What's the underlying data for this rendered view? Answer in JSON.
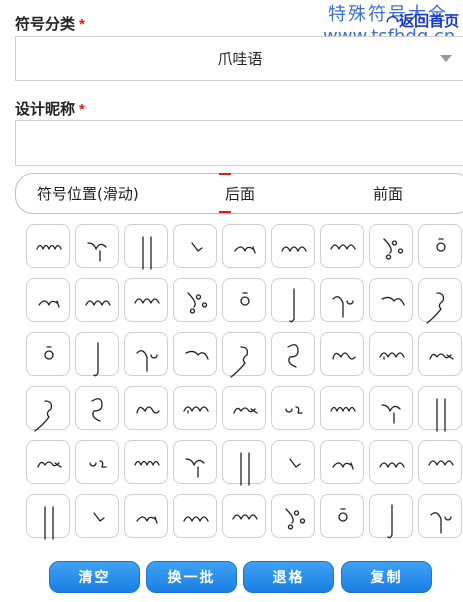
{
  "watermark": {
    "site_name": "特殊符号大全",
    "site_url": "www.tsfhdq.cn"
  },
  "nav": {
    "back_home": "◠返回首页"
  },
  "category": {
    "label": "符号分类",
    "required_mark": "*",
    "selected": "爪哇语"
  },
  "nickname": {
    "label": "设计昵称",
    "required_mark": "*",
    "value": ""
  },
  "position": {
    "label": "符号位置(滑动)",
    "options": [
      "后面",
      "前面"
    ],
    "selected": "后面",
    "accent_color": "#e01b1b"
  },
  "symbols": {
    "rows": 6,
    "columns": 9,
    "glyph_icons": [
      "javanese-ma-icon",
      "javanese-pangkon-icon",
      "javanese-cecak-telu-icon",
      "javanese-wulu-icon",
      "javanese-pa-icon",
      "javanese-ta-icon",
      "javanese-dha-icon",
      "javanese-ja-icon",
      "javanese-ya-icon",
      "javanese-suku-icon",
      "javanese-ga-icon",
      "javanese-pengkal-icon",
      "javanese-cakra-icon",
      "javanese-pepet-icon",
      "javanese-tarung-icon",
      "javanese-na-icon",
      "javanese-wa-icon",
      "javanese-la-icon",
      "javanese-ca-icon",
      "javanese-ra-icon",
      "javanese-ka-icon",
      "javanese-pasangan-icon",
      "javanese-da-icon",
      "javanese-sa-icon",
      "javanese-zero-icon",
      "javanese-ha-icon",
      "javanese-nya-icon",
      "javanese-ba-icon",
      "javanese-pangrangkep-icon",
      "javanese-nga-icon",
      "javanese-ba-murda-icon",
      "javanese-ya-alt-icon",
      "javanese-taling-icon",
      "javanese-cecak-icon",
      "javanese-tha-icon",
      "javanese-ga-murda-icon",
      "javanese-a-icon",
      "javanese-lingsa-icon",
      "javanese-ca-murda-icon",
      "javanese-ja-ligature-icon",
      "javanese-ha-alt-icon",
      "javanese-ka-murda-icon",
      "javanese-pa-ligature-icon",
      "javanese-na-murda-icon",
      "javanese-nol-icon",
      "javanese-ma-alt-icon",
      "javanese-ka-pasangan-icon",
      "javanese-ba-alt-icon",
      "javanese-pada-icon",
      "javanese-ta-murda-icon",
      "javanese-sa-pasangan-icon",
      "javanese-dha-pasangan-icon",
      "javanese-tolong-icon",
      "javanese-layar-icon"
    ]
  },
  "actions": {
    "clear": "清空",
    "swap": "换一批",
    "backspace": "退格",
    "copy": "复制"
  },
  "colors": {
    "button": "#2a8ef0",
    "watermark": "#3b6fd1",
    "link": "#1a39c8",
    "required": "#e01b1b"
  }
}
